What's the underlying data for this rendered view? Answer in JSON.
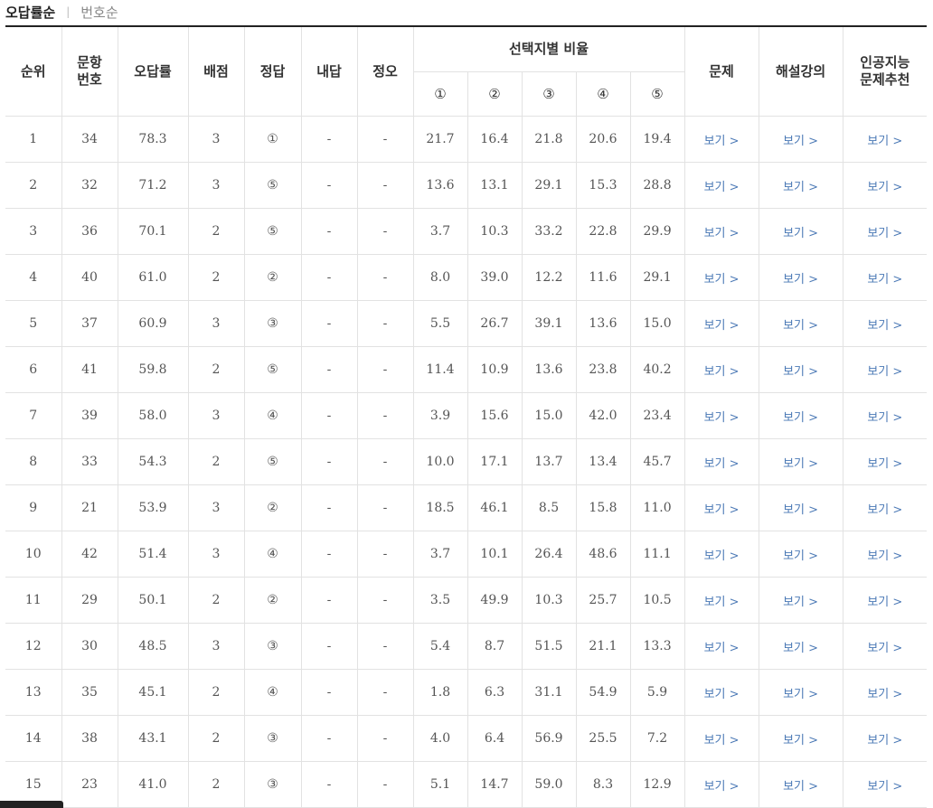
{
  "tabs": {
    "active": "오답률순",
    "inactive": "번호순"
  },
  "headers": {
    "rank": "순위",
    "item_no_1": "문항",
    "item_no_2": "번호",
    "wrong_rate": "오답률",
    "points": "배점",
    "answer": "정답",
    "my_answer": "내답",
    "correct_wrong": "정오",
    "choice_ratio": "선택지별 비율",
    "choices": [
      "①",
      "②",
      "③",
      "④",
      "⑤"
    ],
    "problem": "문제",
    "lecture": "해설강의",
    "ai_1": "인공지능",
    "ai_2": "문제추천"
  },
  "link_label": "보기 >",
  "rows": [
    {
      "rank": "1",
      "item": "34",
      "wrong": "78.3",
      "points": "3",
      "answer": "①",
      "mine": "-",
      "ox": "-",
      "choices": [
        "21.7",
        "16.4",
        "21.8",
        "20.6",
        "19.4"
      ]
    },
    {
      "rank": "2",
      "item": "32",
      "wrong": "71.2",
      "points": "3",
      "answer": "⑤",
      "mine": "-",
      "ox": "-",
      "choices": [
        "13.6",
        "13.1",
        "29.1",
        "15.3",
        "28.8"
      ]
    },
    {
      "rank": "3",
      "item": "36",
      "wrong": "70.1",
      "points": "2",
      "answer": "⑤",
      "mine": "-",
      "ox": "-",
      "choices": [
        "3.7",
        "10.3",
        "33.2",
        "22.8",
        "29.9"
      ]
    },
    {
      "rank": "4",
      "item": "40",
      "wrong": "61.0",
      "points": "2",
      "answer": "②",
      "mine": "-",
      "ox": "-",
      "choices": [
        "8.0",
        "39.0",
        "12.2",
        "11.6",
        "29.1"
      ]
    },
    {
      "rank": "5",
      "item": "37",
      "wrong": "60.9",
      "points": "3",
      "answer": "③",
      "mine": "-",
      "ox": "-",
      "choices": [
        "5.5",
        "26.7",
        "39.1",
        "13.6",
        "15.0"
      ]
    },
    {
      "rank": "6",
      "item": "41",
      "wrong": "59.8",
      "points": "2",
      "answer": "⑤",
      "mine": "-",
      "ox": "-",
      "choices": [
        "11.4",
        "10.9",
        "13.6",
        "23.8",
        "40.2"
      ]
    },
    {
      "rank": "7",
      "item": "39",
      "wrong": "58.0",
      "points": "3",
      "answer": "④",
      "mine": "-",
      "ox": "-",
      "choices": [
        "3.9",
        "15.6",
        "15.0",
        "42.0",
        "23.4"
      ]
    },
    {
      "rank": "8",
      "item": "33",
      "wrong": "54.3",
      "points": "2",
      "answer": "⑤",
      "mine": "-",
      "ox": "-",
      "choices": [
        "10.0",
        "17.1",
        "13.7",
        "13.4",
        "45.7"
      ]
    },
    {
      "rank": "9",
      "item": "21",
      "wrong": "53.9",
      "points": "3",
      "answer": "②",
      "mine": "-",
      "ox": "-",
      "choices": [
        "18.5",
        "46.1",
        "8.5",
        "15.8",
        "11.0"
      ]
    },
    {
      "rank": "10",
      "item": "42",
      "wrong": "51.4",
      "points": "3",
      "answer": "④",
      "mine": "-",
      "ox": "-",
      "choices": [
        "3.7",
        "10.1",
        "26.4",
        "48.6",
        "11.1"
      ]
    },
    {
      "rank": "11",
      "item": "29",
      "wrong": "50.1",
      "points": "2",
      "answer": "②",
      "mine": "-",
      "ox": "-",
      "choices": [
        "3.5",
        "49.9",
        "10.3",
        "25.7",
        "10.5"
      ]
    },
    {
      "rank": "12",
      "item": "30",
      "wrong": "48.5",
      "points": "3",
      "answer": "③",
      "mine": "-",
      "ox": "-",
      "choices": [
        "5.4",
        "8.7",
        "51.5",
        "21.1",
        "13.3"
      ]
    },
    {
      "rank": "13",
      "item": "35",
      "wrong": "45.1",
      "points": "2",
      "answer": "④",
      "mine": "-",
      "ox": "-",
      "choices": [
        "1.8",
        "6.3",
        "31.1",
        "54.9",
        "5.9"
      ]
    },
    {
      "rank": "14",
      "item": "38",
      "wrong": "43.1",
      "points": "2",
      "answer": "③",
      "mine": "-",
      "ox": "-",
      "choices": [
        "4.0",
        "6.4",
        "56.9",
        "25.5",
        "7.2"
      ]
    },
    {
      "rank": "15",
      "item": "23",
      "wrong": "41.0",
      "points": "2",
      "answer": "③",
      "mine": "-",
      "ox": "-",
      "choices": [
        "5.1",
        "14.7",
        "59.0",
        "8.3",
        "12.9"
      ]
    }
  ],
  "colors": {
    "link": "#4a78b5",
    "dash_red": "#d43c3c",
    "header_border": "#222222"
  }
}
